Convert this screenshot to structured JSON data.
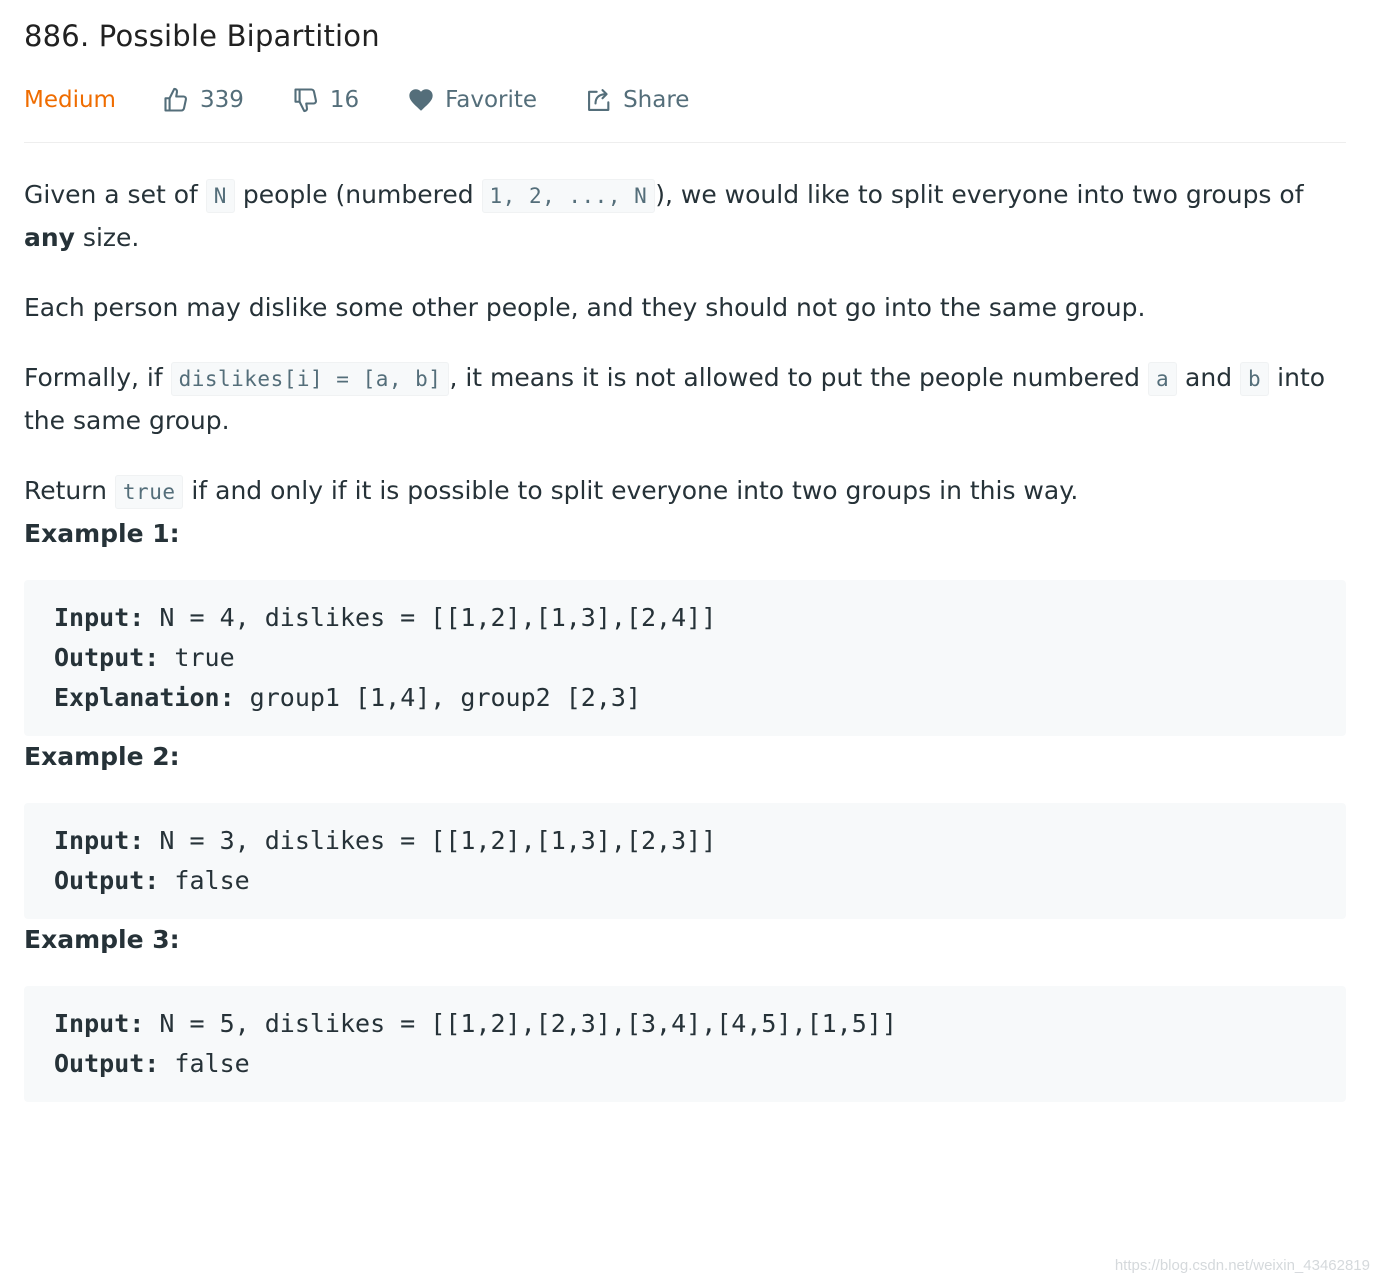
{
  "problem": {
    "title": "886. Possible Bipartition",
    "difficulty": "Medium",
    "likes": "339",
    "dislikes": "16",
    "favorite_label": "Favorite",
    "share_label": "Share"
  },
  "description": {
    "p1": {
      "t1": "Given a set of ",
      "c1": "N",
      "t2": " people (numbered ",
      "c2": "1, 2, ..., N",
      "t3": "), we would like to split everyone into two groups of ",
      "bold": "any",
      "t4": " size."
    },
    "p2": "Each person may dislike some other people, and they should not go into the same group.",
    "p3": {
      "t1": "Formally, if ",
      "c1": "dislikes[i] = [a, b]",
      "t2": ", it means it is not allowed to put the people numbered ",
      "c2": "a",
      "t3": " and ",
      "c3": "b",
      "t4": " into the same group."
    },
    "p4": {
      "t1": "Return ",
      "c1": "true",
      "t2": " if and only if it is possible to split everyone into two groups in this way."
    }
  },
  "examples": [
    {
      "title": "Example 1:",
      "input_label": "Input:",
      "input_value": " N = 4, dislikes = [[1,2],[1,3],[2,4]]",
      "output_label": "Output:",
      "output_value": " true",
      "explanation_label": "Explanation:",
      "explanation_value": " group1 [1,4], group2 [2,3]"
    },
    {
      "title": "Example 2:",
      "input_label": "Input:",
      "input_value": " N = 3, dislikes = [[1,2],[1,3],[2,3]]",
      "output_label": "Output:",
      "output_value": " false"
    },
    {
      "title": "Example 3:",
      "input_label": "Input:",
      "input_value": " N = 5, dislikes = [[1,2],[2,3],[3,4],[4,5],[1,5]]",
      "output_label": "Output:",
      "output_value": " false"
    }
  ],
  "watermark": "https://blog.csdn.net/weixin_43462819",
  "colors": {
    "difficulty_medium": "#ef6c00",
    "meta_text": "#546e7a",
    "code_bg": "#f7f9fa"
  },
  "icons": {
    "like": "thumbs-up-icon",
    "dislike": "thumbs-down-icon",
    "favorite": "heart-icon",
    "share": "share-icon"
  }
}
